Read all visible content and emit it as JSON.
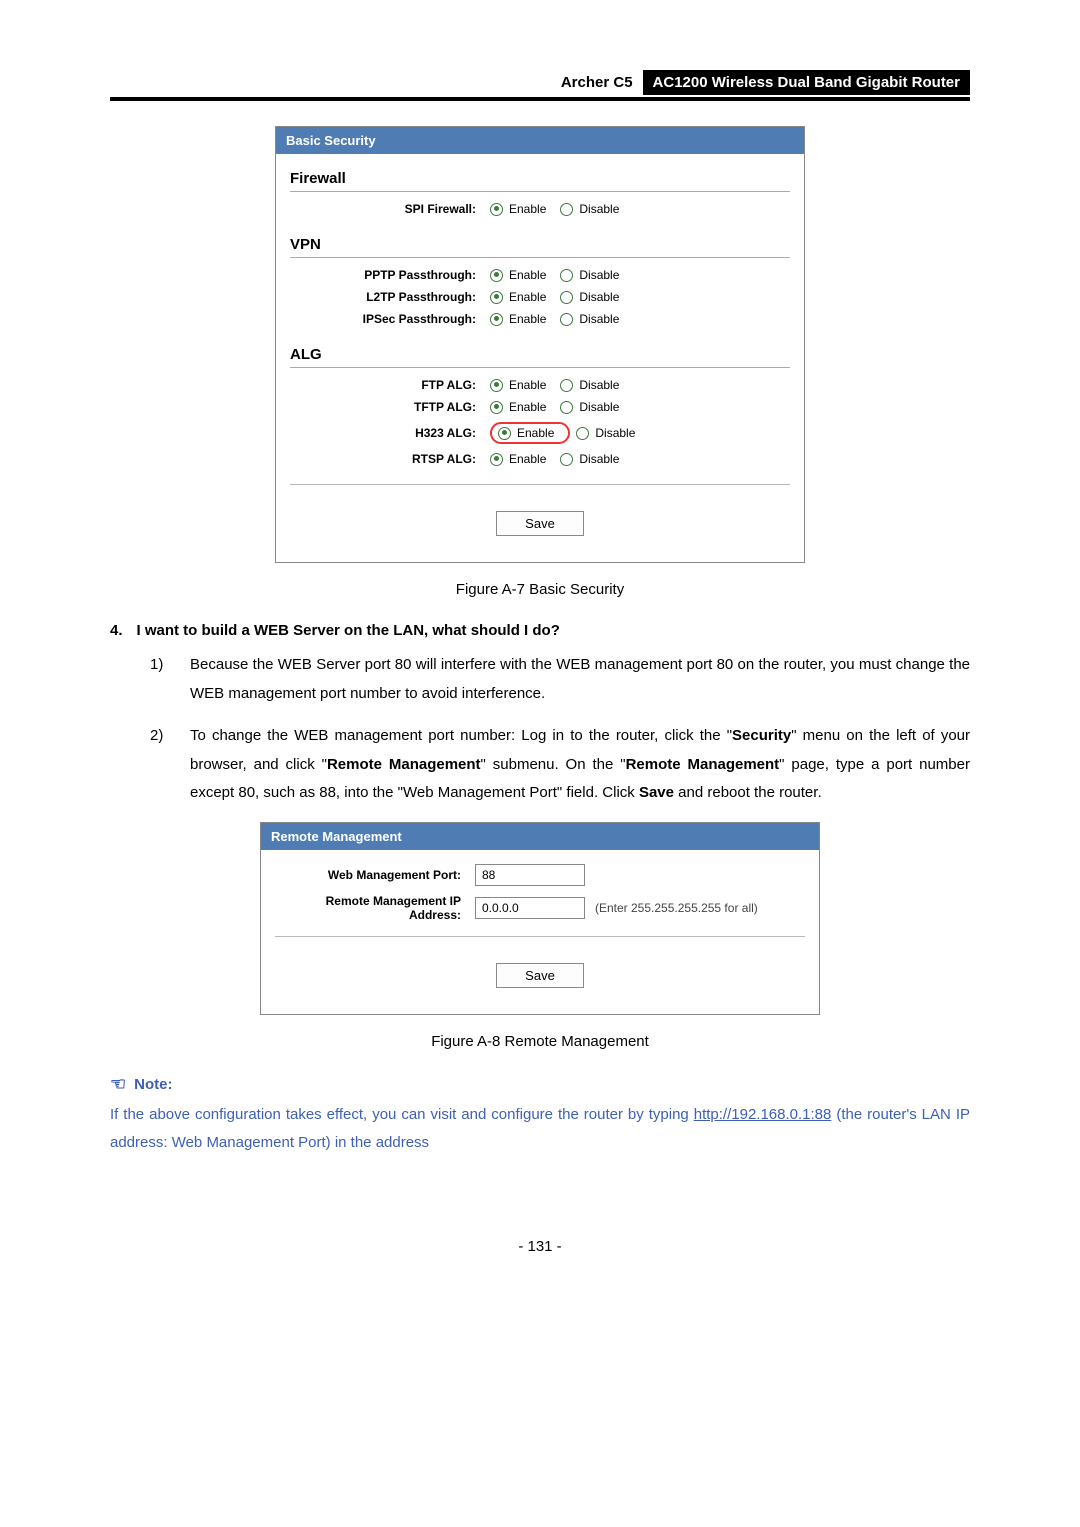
{
  "header": {
    "model": "Archer C5",
    "product": "AC1200 Wireless Dual Band Gigabit Router"
  },
  "basic_security": {
    "title": "Basic Security",
    "sections": {
      "firewall": {
        "title": "Firewall",
        "rows": [
          {
            "label": "SPI Firewall:",
            "enable": "Enable",
            "disable": "Disable",
            "selected": "enable"
          }
        ]
      },
      "vpn": {
        "title": "VPN",
        "rows": [
          {
            "label": "PPTP Passthrough:",
            "enable": "Enable",
            "disable": "Disable",
            "selected": "enable"
          },
          {
            "label": "L2TP Passthrough:",
            "enable": "Enable",
            "disable": "Disable",
            "selected": "enable"
          },
          {
            "label": "IPSec Passthrough:",
            "enable": "Enable",
            "disable": "Disable",
            "selected": "enable"
          }
        ]
      },
      "alg": {
        "title": "ALG",
        "rows": [
          {
            "label": "FTP ALG:",
            "enable": "Enable",
            "disable": "Disable",
            "selected": "enable"
          },
          {
            "label": "TFTP ALG:",
            "enable": "Enable",
            "disable": "Disable",
            "selected": "enable"
          },
          {
            "label": "H323 ALG:",
            "enable": "Enable",
            "disable": "Disable",
            "selected": "enable",
            "highlight": true
          },
          {
            "label": "RTSP ALG:",
            "enable": "Enable",
            "disable": "Disable",
            "selected": "enable"
          }
        ]
      }
    },
    "save": "Save",
    "caption": "Figure A-7 Basic Security"
  },
  "question": {
    "number": "4.",
    "text": "I want to build a WEB Server on the LAN, what should I do?"
  },
  "steps": {
    "s1_num": "1)",
    "s1_pre": "Because the WEB Server port 80 will interfere with the WEB management port 80 on the router, you must change the WEB management port number to avoid interference.",
    "s2_num": "2)",
    "s2_a": "To change the WEB management port number: Log in to the router, click the \"",
    "s2_b": "Security",
    "s2_c": "\" menu on the left of your browser, and click \"",
    "s2_d": "Remote Management",
    "s2_e": "\" submenu. On the \"",
    "s2_f": "Remote Management",
    "s2_g": "\" page, type a port number except 80, such as 88, into the \"Web Management Port\" field. Click ",
    "s2_h": "Save",
    "s2_i": " and reboot the router."
  },
  "remote_mgmt": {
    "title": "Remote Management",
    "port_label": "Web Management Port:",
    "port_value": "88",
    "ip_label": "Remote Management IP Address:",
    "ip_value": "0.0.0.0",
    "ip_hint": "(Enter 255.255.255.255 for all)",
    "save": "Save",
    "caption": "Figure A-8 Remote Management"
  },
  "note": {
    "label": "Note:",
    "body_a": "If the above configuration takes effect, you can visit and configure the router by typing ",
    "link": "http://192.168.0.1:88",
    "body_b": " (the router's LAN IP address: Web Management Port) in the address"
  },
  "page_number": "- 131 -"
}
